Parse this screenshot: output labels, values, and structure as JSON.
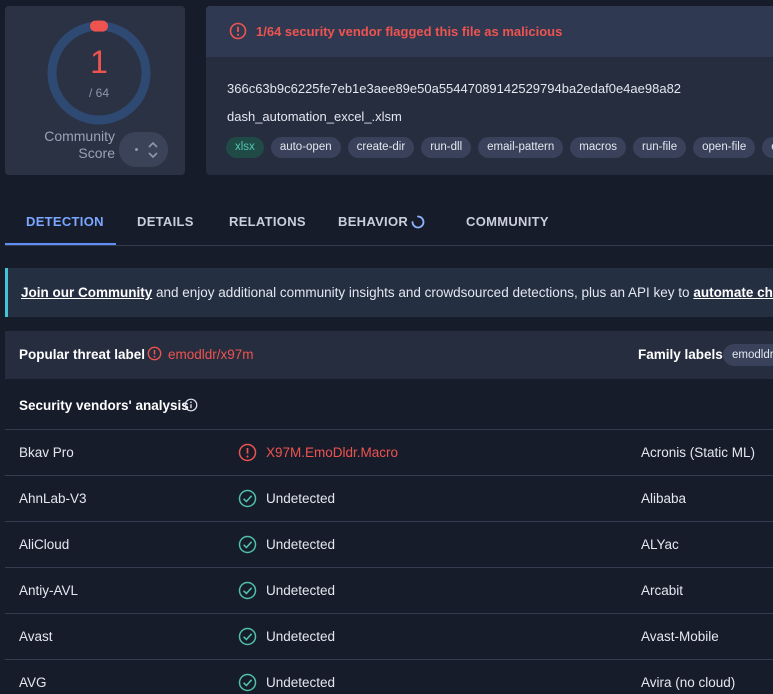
{
  "score": {
    "detections": "1",
    "total": "/ 64",
    "community_label_line1": "Community",
    "community_label_line2": "Score",
    "colors": {
      "ring": "#2e4a73",
      "danger": "#ef5350"
    }
  },
  "file": {
    "alert": "1/64 security vendor flagged this file as malicious",
    "hash": "366c63b9c6225fe7eb1e3aee89e50a55447089142529794ba2edaf0e4ae98a82",
    "name": "dash_automation_excel_.xlsm",
    "tags": [
      "xlsx",
      "auto-open",
      "create-dir",
      "run-dll",
      "email-pattern",
      "macros",
      "run-file",
      "open-file",
      "exe-"
    ]
  },
  "tabs": {
    "detection": "DETECTION",
    "details": "DETAILS",
    "relations": "RELATIONS",
    "behavior": "BEHAVIOR",
    "community": "COMMUNITY"
  },
  "banner": {
    "link1": "Join our Community",
    "middle": " and enjoy additional community insights and crowdsourced detections, plus an API key to ",
    "link2": "automate check"
  },
  "threat": {
    "title": "Popular threat label",
    "value": "emodldr/x97m",
    "family_title": "Family labels",
    "family_tag": "emodldr"
  },
  "vendors": {
    "title": "Security vendors' analysis",
    "rows": [
      {
        "name": "Bkav Pro",
        "result": "X97M.EmoDldr.Macro",
        "name2": "Acronis (Static ML)"
      },
      {
        "name": "AhnLab-V3",
        "result": "Undetected",
        "name2": "Alibaba"
      },
      {
        "name": "AliCloud",
        "result": "Undetected",
        "name2": "ALYac"
      },
      {
        "name": "Antiy-AVL",
        "result": "Undetected",
        "name2": "Arcabit"
      },
      {
        "name": "Avast",
        "result": "Undetected",
        "name2": "Avast-Mobile"
      },
      {
        "name": "AVG",
        "result": "Undetected",
        "name2": "Avira (no cloud)"
      }
    ]
  }
}
